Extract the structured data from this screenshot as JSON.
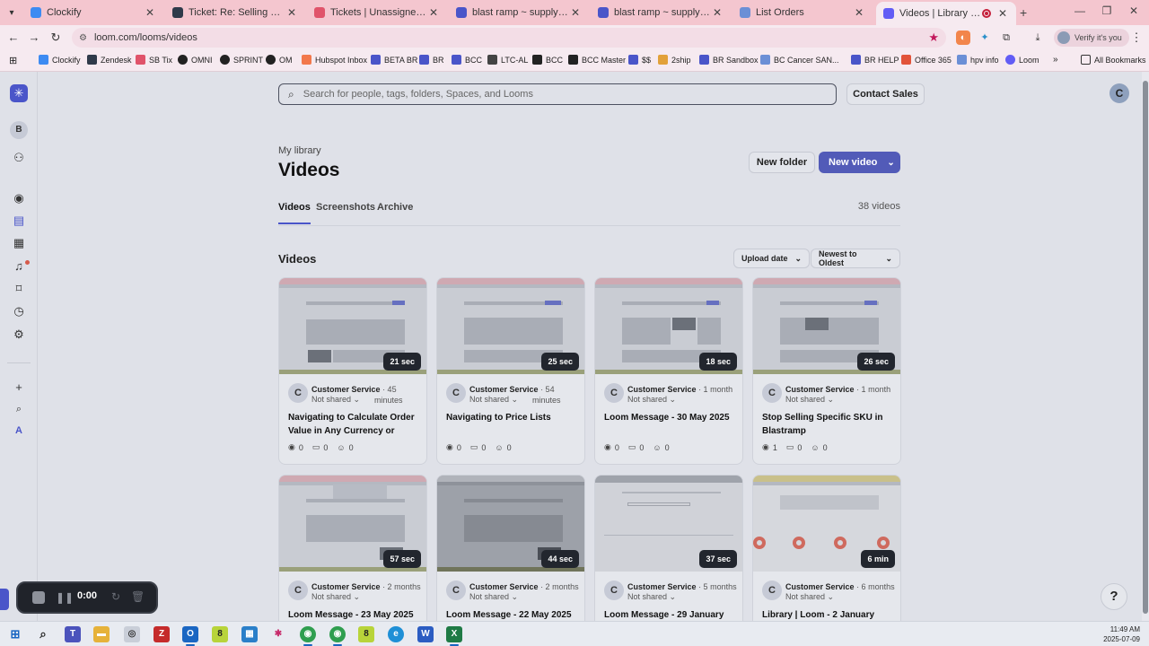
{
  "browser": {
    "tabs": [
      {
        "title": "Clockify",
        "color": "#3d8bf2"
      },
      {
        "title": "Ticket: Re: Selling US Inventory",
        "color": "#2f3a4a"
      },
      {
        "title": "Tickets | Unassigned tickets",
        "color": "#e0536a"
      },
      {
        "title": "blast ramp ~ supply on deman",
        "color": "#4a55c9"
      },
      {
        "title": "blast ramp ~ supply on deman",
        "color": "#4a55c9"
      },
      {
        "title": "List Orders",
        "color": "#6b8fd6"
      },
      {
        "title": "Videos | Library | Loom",
        "color": "#625df5"
      }
    ],
    "url": "loom.com/looms/videos",
    "verify_label": "Verify it's you",
    "bookmarks": [
      {
        "label": "Clockify",
        "color": "#3d8bf2"
      },
      {
        "label": "Zendesk",
        "color": "#2f3a4a"
      },
      {
        "label": "SB Tix",
        "color": "#e0536a"
      },
      {
        "label": "OMNI",
        "color": "#222222"
      },
      {
        "label": "SPRINT",
        "color": "#222222"
      },
      {
        "label": "OM",
        "color": "#222222"
      },
      {
        "label": "Hubspot Inbox",
        "color": "#f2784b"
      },
      {
        "label": "BETA BR",
        "color": "#4a55c9"
      },
      {
        "label": "BR",
        "color": "#4a55c9"
      },
      {
        "label": "BCC",
        "color": "#4a55c9"
      },
      {
        "label": "LTC-AL",
        "color": "#444444"
      },
      {
        "label": "BCC",
        "color": "#222222"
      },
      {
        "label": "BCC Master",
        "color": "#222222"
      },
      {
        "label": "$$",
        "color": "#4a55c9"
      },
      {
        "label": "2ship",
        "color": "#e2a13a"
      },
      {
        "label": "BR Sandbox",
        "color": "#4a55c9"
      },
      {
        "label": "BC Cancer SAN...",
        "color": "#6b8fd6"
      },
      {
        "label": "BR HELP",
        "color": "#4a55c9"
      },
      {
        "label": "Office 365",
        "color": "#e2533a"
      },
      {
        "label": "hpv info",
        "color": "#6b8fd6"
      },
      {
        "label": "Loom",
        "color": "#625df5"
      }
    ],
    "all_bookmarks_label": "All Bookmarks"
  },
  "sidebar": {
    "workspace_initial": "B",
    "last_initial": "A"
  },
  "header": {
    "search_placeholder": "Search for people, tags, folders, Spaces, and Looms",
    "contact_sales": "Contact Sales",
    "user_initial": "C"
  },
  "library": {
    "breadcrumb": "My library",
    "title": "Videos",
    "new_folder": "New folder",
    "new_video": "New video",
    "tabs": [
      "Videos",
      "Screenshots",
      "Archive"
    ],
    "count": "38 videos",
    "section_title": "Videos",
    "sort_field": "Upload date",
    "sort_order": "Newest to Oldest"
  },
  "videos": [
    {
      "duration": "21 sec",
      "author": "Customer Service",
      "when": "· 45",
      "when2": "minutes",
      "sharing": "Not shared",
      "title": "Navigating to Calculate Order Value in Any Currency or Pric...",
      "views": "0",
      "comments": "0",
      "reactions": "0"
    },
    {
      "duration": "25 sec",
      "author": "Customer Service",
      "when": "· 54",
      "when2": "minutes",
      "sharing": "Not shared",
      "title": "Navigating to Price Lists",
      "views": "0",
      "comments": "0",
      "reactions": "0"
    },
    {
      "duration": "18 sec",
      "author": "Customer Service",
      "when": "· 1 month",
      "when2": "",
      "sharing": "Not shared",
      "title": "Loom Message - 30 May 2025",
      "views": "0",
      "comments": "0",
      "reactions": "0"
    },
    {
      "duration": "26 sec",
      "author": "Customer Service",
      "when": "· 1 month",
      "when2": "",
      "sharing": "Not shared",
      "title": "Stop Selling Specific SKU in Blastramp",
      "views": "1",
      "comments": "0",
      "reactions": "0"
    },
    {
      "duration": "57 sec",
      "author": "Customer Service",
      "when": "· 2 months",
      "when2": "",
      "sharing": "Not shared",
      "title": "Loom Message - 23 May 2025"
    },
    {
      "duration": "44 sec",
      "author": "Customer Service",
      "when": "· 2 months",
      "when2": "",
      "sharing": "Not shared",
      "title": "Loom Message - 22 May 2025"
    },
    {
      "duration": "37 sec",
      "author": "Customer Service",
      "when": "· 5 months",
      "when2": "",
      "sharing": "Not shared",
      "title": "Loom Message - 29 January"
    },
    {
      "duration": "6 min",
      "author": "Customer Service",
      "when": "· 6 months",
      "when2": "",
      "sharing": "Not shared",
      "title": "Library | Loom - 2 January"
    }
  ],
  "recorder": {
    "time": "0:00"
  },
  "taskbar": {
    "time": "11:49 AM",
    "date": "2025-07-09"
  }
}
